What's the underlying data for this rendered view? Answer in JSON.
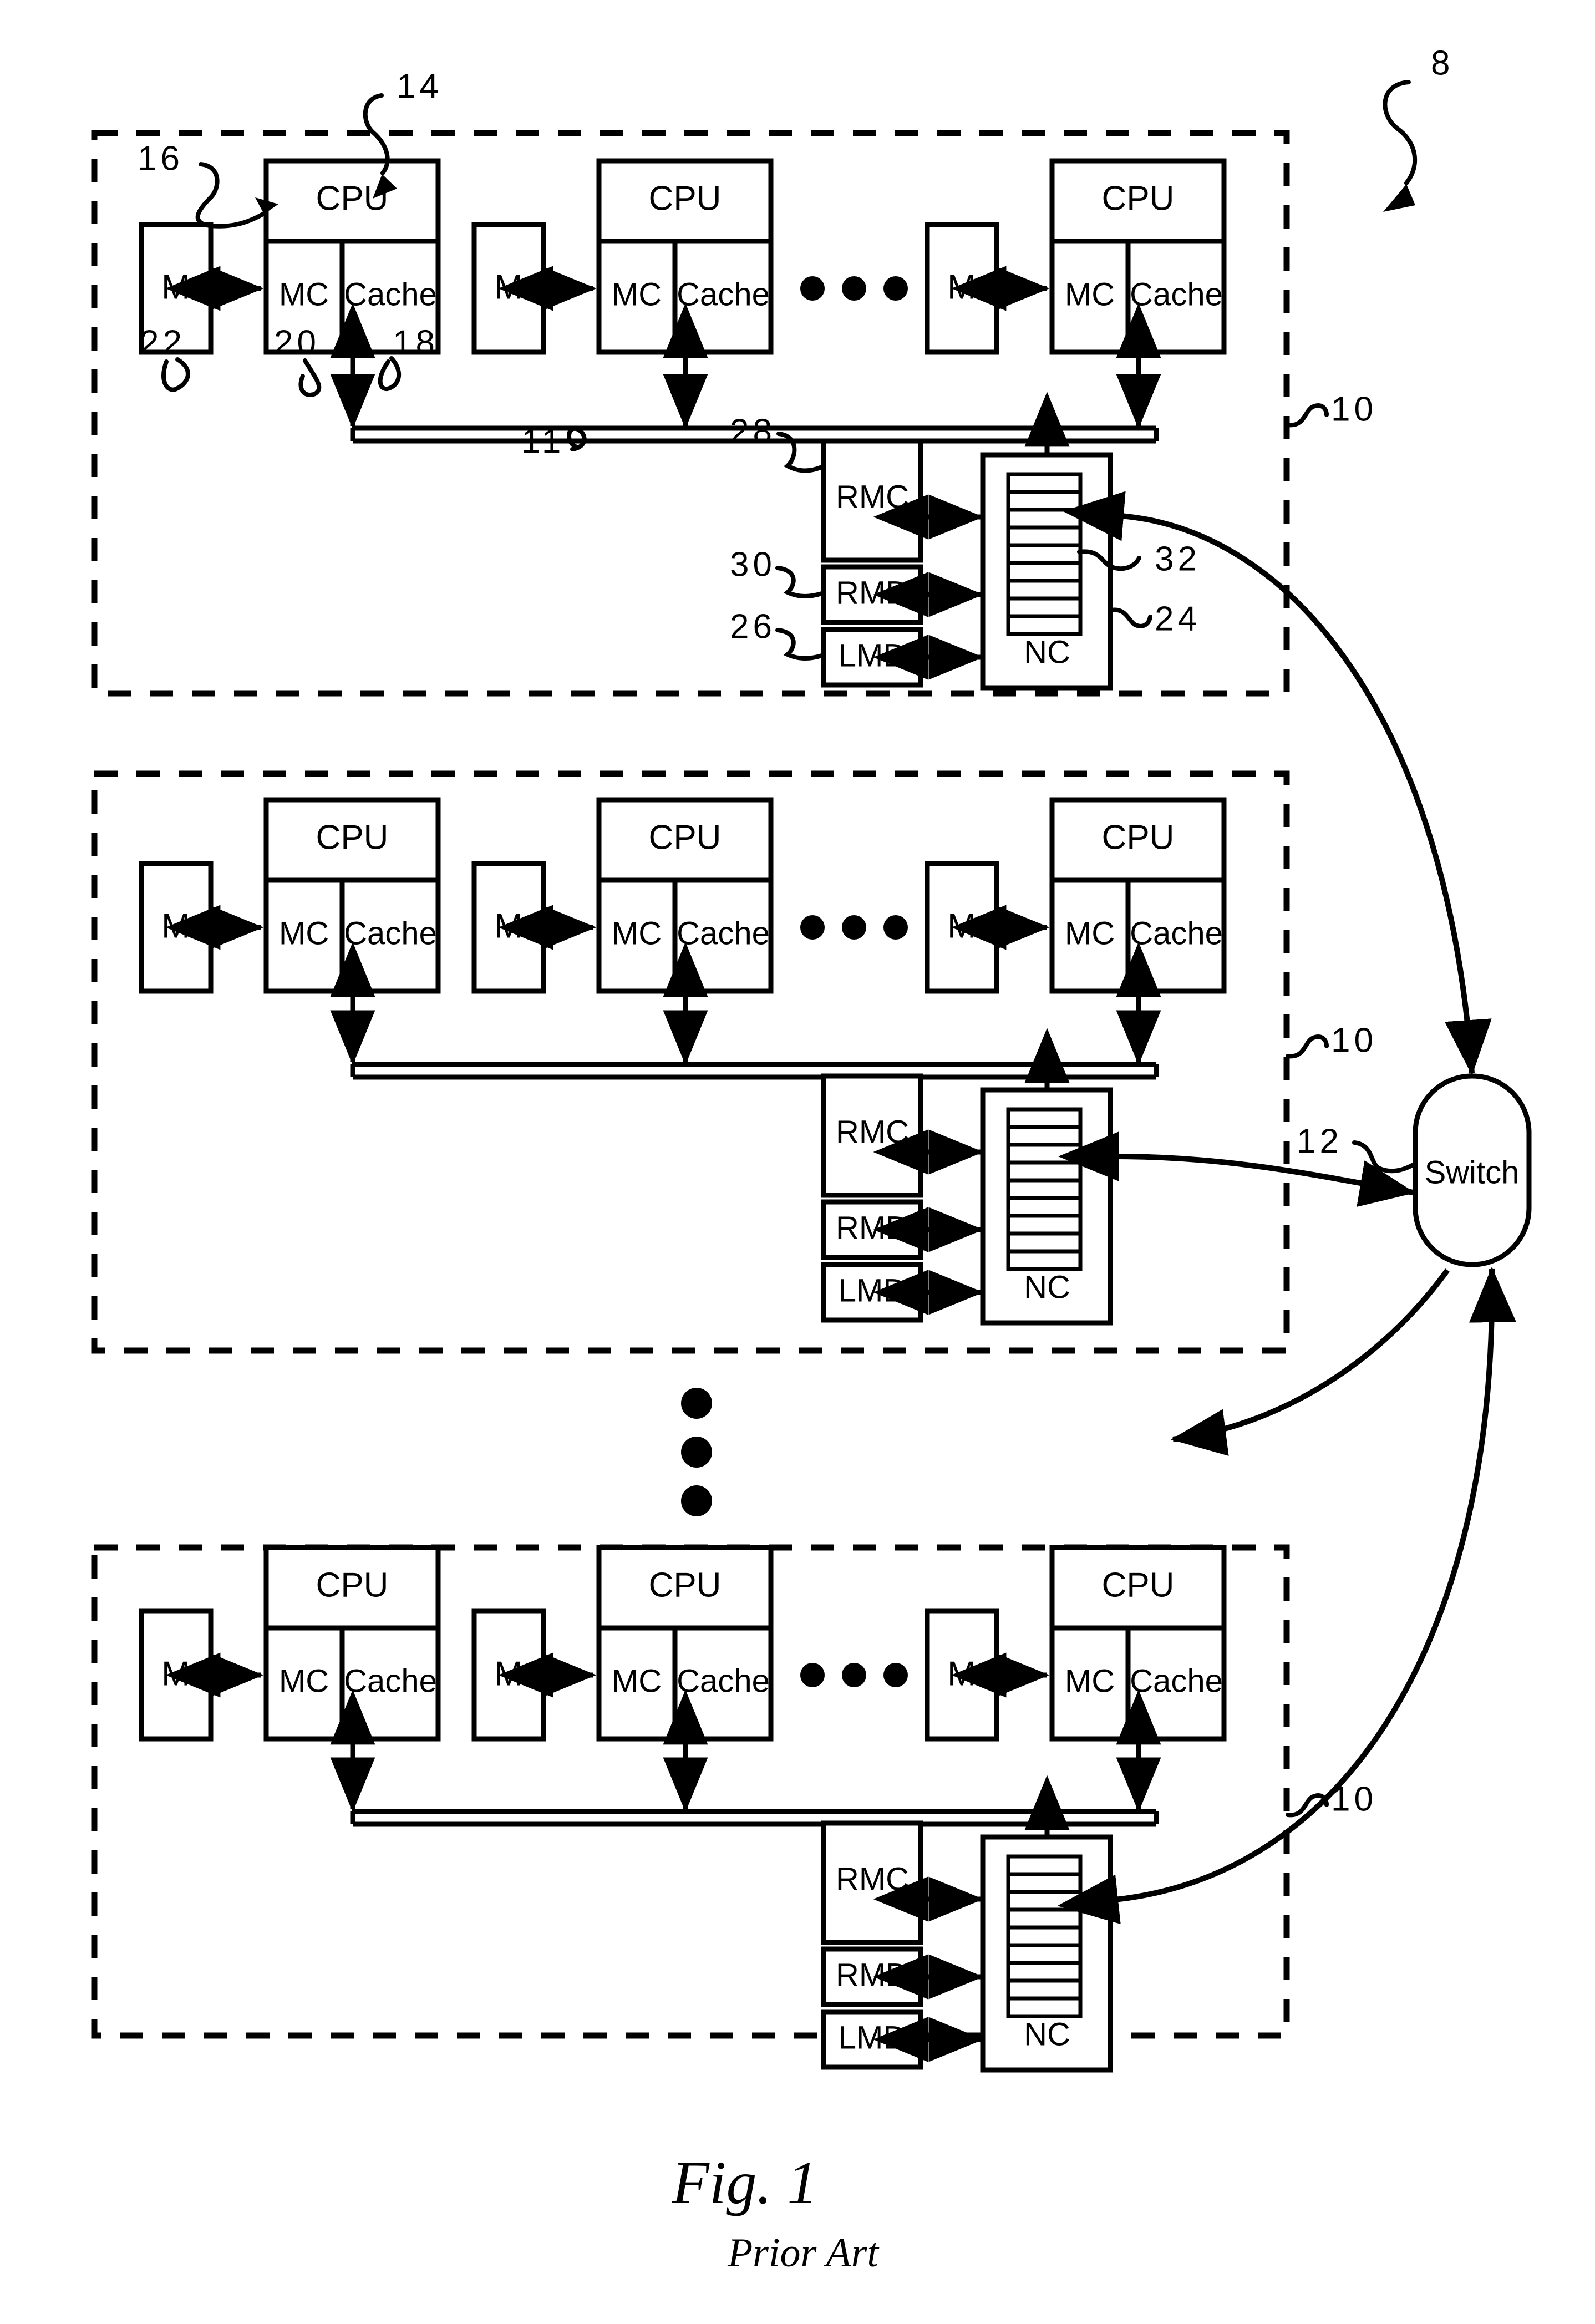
{
  "figure": {
    "caption_main": "Fig. 1",
    "caption_sub": "Prior Art",
    "overall_ref": "8"
  },
  "labels": {
    "cpu": "CPU",
    "mc": "MC",
    "cache": "Cache",
    "memory": "M",
    "rmc": "RMC",
    "rmd": "RMD",
    "lmd": "LMD",
    "nc": "NC",
    "switch": "Switch"
  },
  "reference_numerals": {
    "system": "8",
    "node": "10",
    "bus": "11",
    "interconnect": "12",
    "processing_unit": "14",
    "cpu_core": "16",
    "bus_link": "18",
    "memory_controller": "20",
    "system_memory": "22",
    "node_controller": "24",
    "local_memory_directory": "26",
    "remote_memory_cache": "28",
    "remote_memory_directory": "30",
    "queue": "32"
  },
  "nodes": [
    {
      "id": "node-1",
      "ref": "10",
      "processing_units": 3,
      "ellipsis_between": true,
      "nc_ref": "24",
      "queue_ref": "32",
      "rmc_ref": "28",
      "rmd_ref": "30",
      "lmd_ref": "26",
      "bus_ref": "11",
      "annotated": true
    },
    {
      "id": "node-2",
      "ref": "10",
      "processing_units": 3,
      "ellipsis_between": true,
      "annotated": false
    },
    {
      "id": "node-3",
      "ref": "10",
      "processing_units": 3,
      "ellipsis_between": true,
      "annotated": false
    }
  ],
  "node_vertical_ellipsis": {
    "dots": 3
  },
  "queue_slots": 9,
  "colors": {
    "ink": "#000000",
    "paper": "#ffffff"
  }
}
